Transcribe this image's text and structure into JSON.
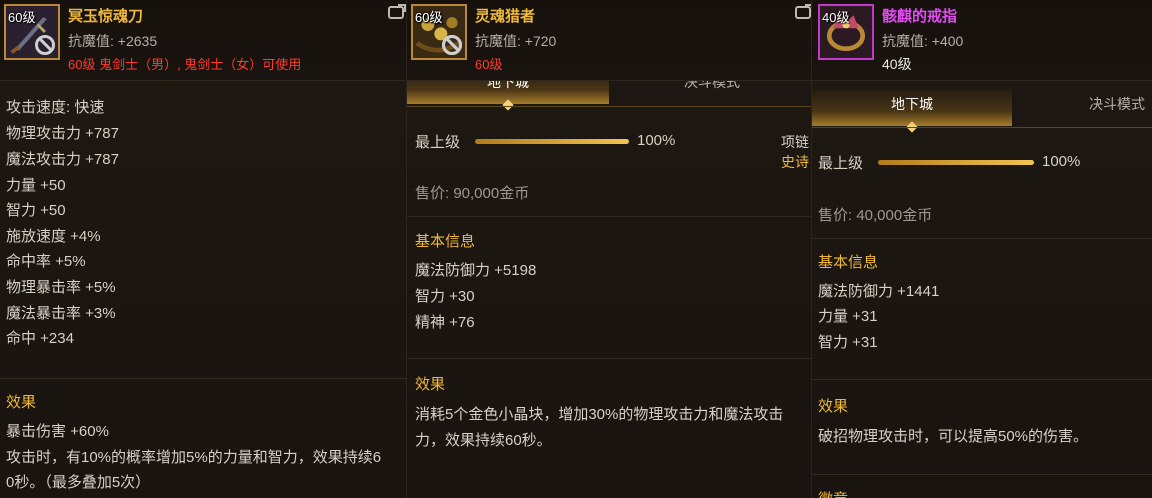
{
  "panels": [
    {
      "item": {
        "level_tag": "60级",
        "name": "冥玉惊魂刀",
        "resist": "抗魔值: +2635",
        "requirement": "60级 鬼剑士（男）, 鬼剑士（女）可使用",
        "icon": "sword-icon",
        "unusable_icon": "no-entry-icon",
        "rarity_color": "#f0b93a"
      },
      "stats": [
        "攻击速度: 快速",
        "物理攻击力 +787",
        "魔法攻击力 +787",
        "力量 +50",
        "智力 +50",
        "施放速度 +4%",
        "命中率 +5%",
        "物理暴击率 +5%",
        "魔法暴击率 +3%",
        "命中 +234"
      ],
      "effect": {
        "title": "效果",
        "line1": "暴击伤害 +60%",
        "line2": "攻击时，有10%的概率增加5%的力量和智力，效果持续6",
        "line3": "0秒。（最多叠加5次）"
      }
    },
    {
      "item": {
        "level_tag": "60级",
        "name": "灵魂猎者",
        "resist": "抗魔值: +720",
        "requirement": "60级",
        "icon": "bullet-belt-icon",
        "unusable_icon": "no-entry-icon",
        "rarity_color": "#f0b93a"
      },
      "tabs": {
        "active": "地下城",
        "inactive": "决斗模式"
      },
      "grade": {
        "label": "最上级",
        "value": "100%",
        "fill": 1.0
      },
      "sell_price": "售价: 90,000金币",
      "basic_title": "基本信息",
      "stats": [
        "魔法防御力 +5198",
        "智力 +30",
        "精神 +76"
      ],
      "effect": {
        "title": "效果",
        "line1": "消耗5个金色小晶块，增加30%的物理攻击力和魔法攻击",
        "line2": "力，效果持续60秒。"
      },
      "side": {
        "type": "项链",
        "rarity": "史诗"
      }
    },
    {
      "item": {
        "level_tag": "40级",
        "name": "骸麒的戒指",
        "resist": "抗魔值: +400",
        "requirement": "40级",
        "icon": "ring-icon",
        "rarity_color": "#e14df0"
      },
      "tabs": {
        "active": "地下城",
        "inactive": "决斗模式"
      },
      "grade": {
        "label": "最上级",
        "value": "100%",
        "fill": 1.0
      },
      "sell_price": "售价: 40,000金币",
      "basic_title": "基本信息",
      "stats": [
        "魔法防御力 +1441",
        "力量 +31",
        "智力 +31"
      ],
      "effect": {
        "title": "效果",
        "line1": "破招物理攻击时，可以提高50%的伤害。"
      },
      "bottom_partial": "徽章"
    }
  ],
  "compare_icon": "compare-icon"
}
